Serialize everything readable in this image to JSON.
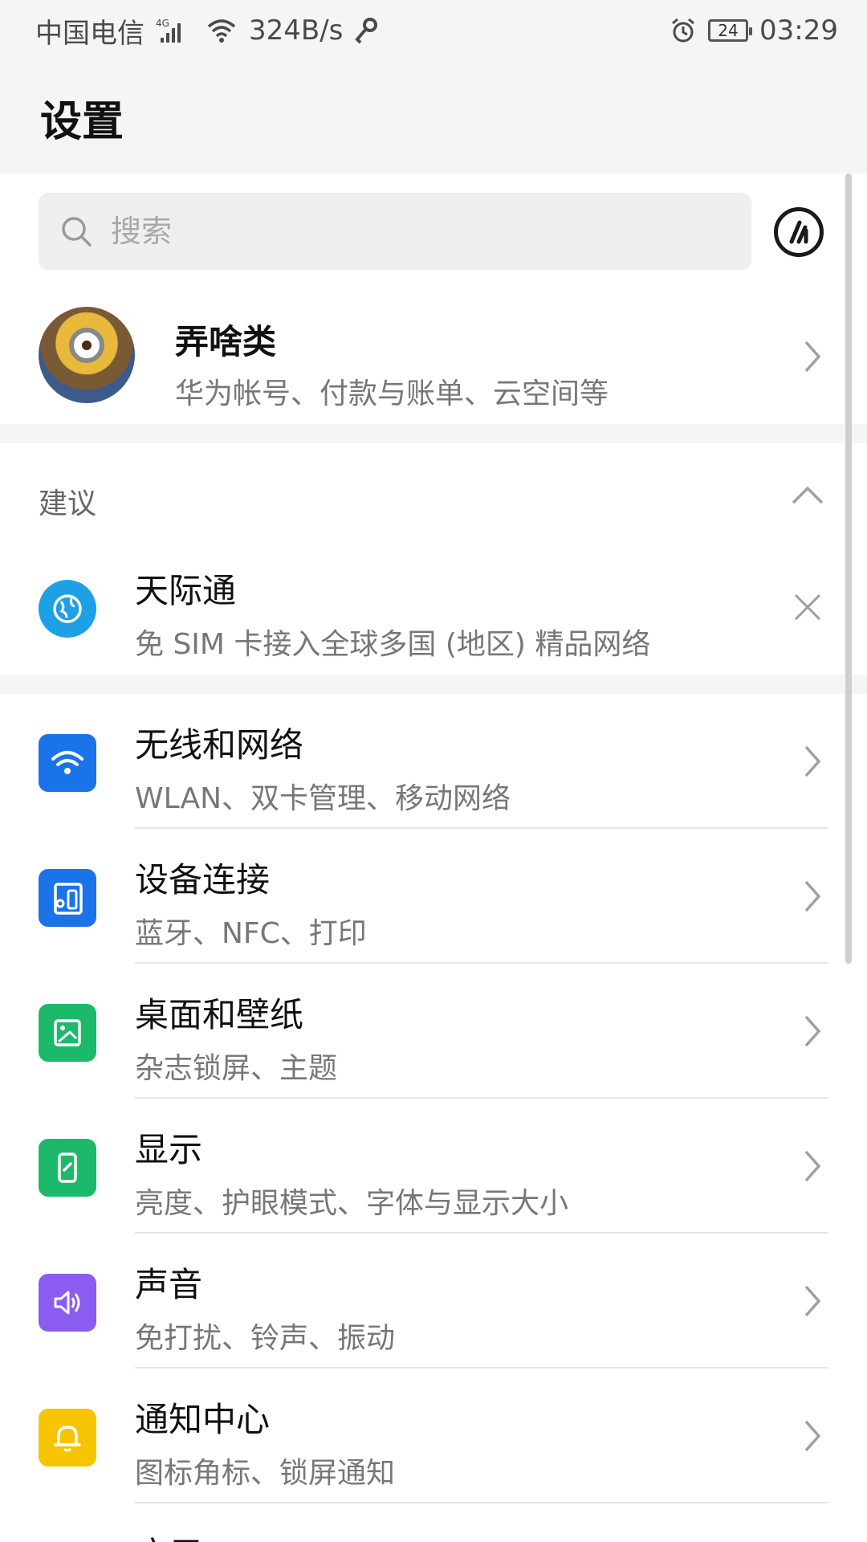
{
  "status_bar": {
    "carrier": "中国电信",
    "net_type": "4G",
    "speed": "324B/s",
    "battery": "24",
    "time": "03:29",
    "icons": [
      "signal-icon",
      "wifi-icon",
      "key-icon",
      "alarm-icon",
      "battery-icon"
    ]
  },
  "header": {
    "title": "设置"
  },
  "search": {
    "placeholder": "搜索"
  },
  "account": {
    "name": "弄啥类",
    "subtitle": "华为帐号、付款与账单、云空间等"
  },
  "suggestions": {
    "title": "建议",
    "item": {
      "title": "天际通",
      "subtitle": "免 SIM 卡接入全球多国 (地区) 精品网络",
      "icon_color": "#1ea0e6"
    }
  },
  "settings": [
    {
      "title": "无线和网络",
      "subtitle": "WLAN、双卡管理、移动网络",
      "icon": "wifi-icon",
      "color": "#1a73e8"
    },
    {
      "title": "设备连接",
      "subtitle": "蓝牙、NFC、打印",
      "icon": "device-connect-icon",
      "color": "#1a73e8"
    },
    {
      "title": "桌面和壁纸",
      "subtitle": "杂志锁屏、主题",
      "icon": "wallpaper-icon",
      "color": "#1db96b"
    },
    {
      "title": "显示",
      "subtitle": "亮度、护眼模式、字体与显示大小",
      "icon": "display-icon",
      "color": "#1db96b"
    },
    {
      "title": "声音",
      "subtitle": "免打扰、铃声、振动",
      "icon": "sound-icon",
      "color": "#8a5cf0"
    },
    {
      "title": "通知中心",
      "subtitle": "图标角标、锁屏通知",
      "icon": "bell-icon",
      "color": "#f6c400"
    },
    {
      "title": "应用",
      "subtitle": "",
      "icon": "apps-icon",
      "color": "#1a73e8"
    }
  ]
}
